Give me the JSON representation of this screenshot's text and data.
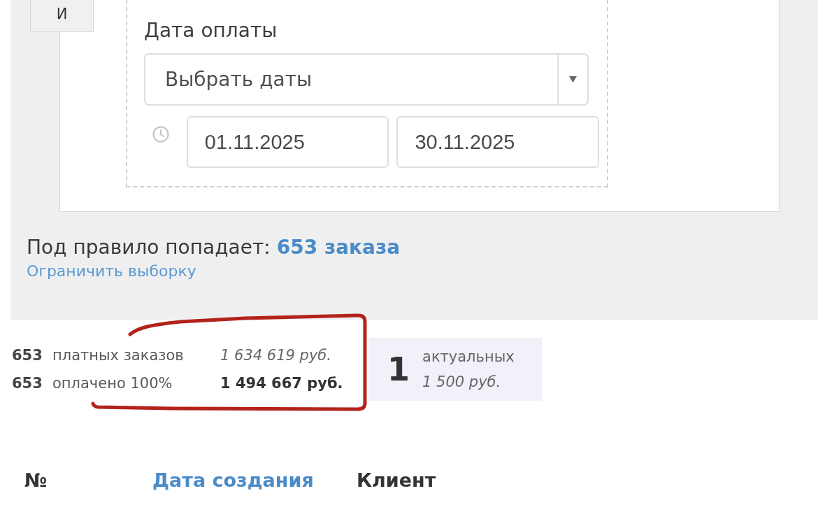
{
  "filter_card": {
    "conjunction_button": "И",
    "payment_date": {
      "label": "Дата оплаты",
      "preset_select": {
        "value": "Выбрать даты"
      },
      "date_from": {
        "value": "01.11.2025"
      },
      "date_to": {
        "value": "30.11.2025"
      }
    }
  },
  "rule_summary": {
    "label": "Под правило попадает:",
    "count_link": "653 заказа",
    "limit_link": "Ограничить выборку"
  },
  "stats": [
    {
      "kind": "billed",
      "count": "653",
      "label": "платных заказов",
      "amount": "1 634 619 руб."
    },
    {
      "kind": "paid",
      "count": "653",
      "label": "оплачено 100%",
      "amount": "1 494 667 руб."
    }
  ],
  "current_card": {
    "count": "1",
    "label": "актуальных",
    "amount": "1 500 руб."
  },
  "annotation": {
    "kind": "freehand-outline"
  },
  "table": {
    "columns": [
      {
        "kind": "plain",
        "label": "№"
      },
      {
        "kind": "sortable",
        "label": "Дата создания"
      },
      {
        "kind": "plain",
        "label": "Клиент"
      }
    ]
  }
}
